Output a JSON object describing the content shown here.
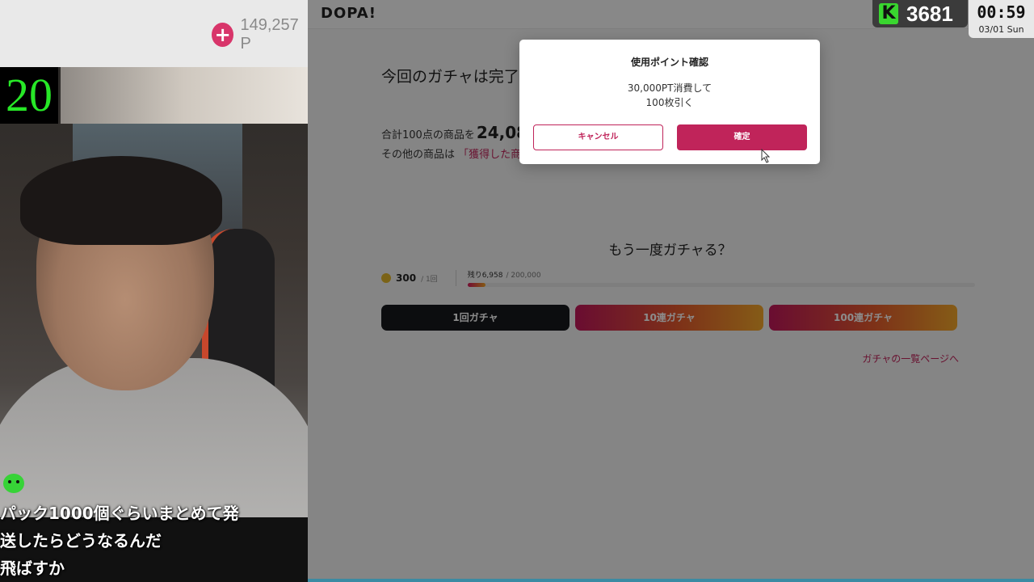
{
  "stream": {
    "points_value": "149,257 P",
    "counter": "20",
    "viewer_count": "3681",
    "clock_time": "00:59",
    "clock_date": "03/01 Sun",
    "comments": [
      "パック1000個ぐらいまとめて発",
      "送したらどうなるんだ",
      "飛ばすか"
    ],
    "icons": {
      "plus": "plus-icon",
      "comment_avatar": "frog-icon",
      "k_logo": "k-logo-icon"
    }
  },
  "site": {
    "logo": "DOPA!",
    "title": "今回のガチャは完了",
    "summary_prefix": "合計100点の商品を",
    "summary_value": "24,08",
    "note_prefix": "その他の商品は",
    "note_link": "「獲得した商",
    "again_title": "もう一度ガチャる？",
    "cost_value": "300",
    "cost_unit": "/ 1回",
    "remaining_label": "残り6,958",
    "remaining_total": "/ 200,000",
    "remaining_fraction": 0.035,
    "buttons": {
      "single": "1回ガチャ",
      "ten": "10連ガチャ",
      "hundred": "100連ガチャ"
    },
    "list_link": "ガチャの一覧ページへ",
    "colors": {
      "accent": "#c0245a",
      "dark": "#16181c",
      "gradient_end": "#f2a72a"
    }
  },
  "modal": {
    "title": "使用ポイント確認",
    "message_line1": "30,000PT消費して",
    "message_line2": "100枚引く",
    "cancel_label": "キャンセル",
    "confirm_label": "確定"
  }
}
